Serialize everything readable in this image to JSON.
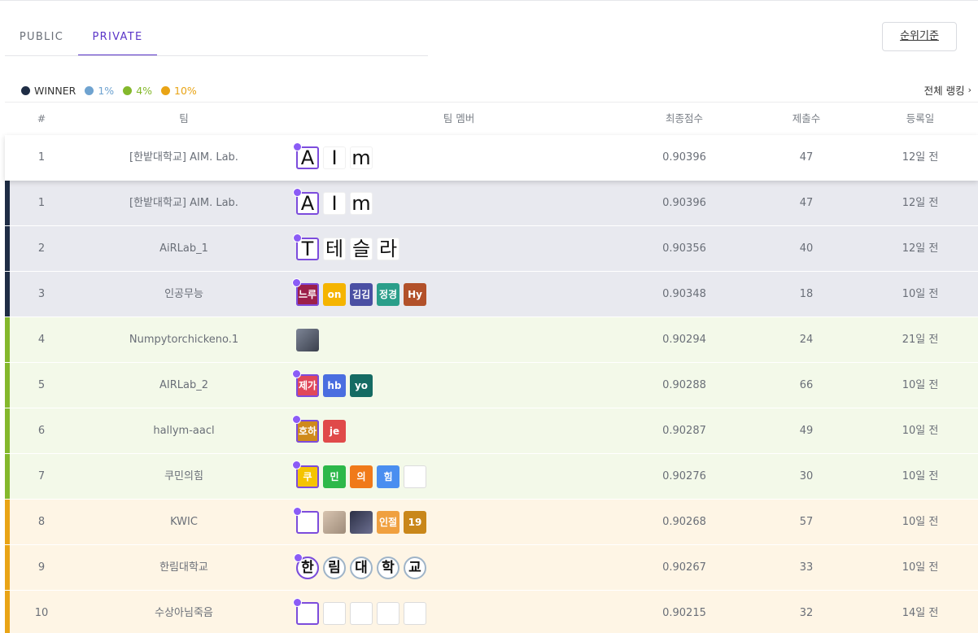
{
  "tabs": [
    {
      "label": "PUBLIC"
    },
    {
      "label": "PRIVATE"
    }
  ],
  "criteria_button": "순위기준",
  "legend": [
    {
      "label": "WINNER",
      "color": "#1f2d45"
    },
    {
      "label": "1%",
      "color": "#6fa3d0"
    },
    {
      "label": "4%",
      "color": "#84b82c"
    },
    {
      "label": "10%",
      "color": "#e9a416"
    }
  ],
  "all_ranking": "전체 랭킹",
  "columns": {
    "rank": "#",
    "team": "팀",
    "members": "팀 멤버",
    "score": "최종점수",
    "submissions": "제출수",
    "date": "등록일"
  },
  "tier_colors": {
    "winner": {
      "bar": "#1f2d45",
      "bg": "#e8e9ef"
    },
    "four": {
      "bar": "#84b82c",
      "bg": "#f3f9e9"
    },
    "ten": {
      "bar": "#e9a416",
      "bg": "#fef5e5"
    }
  },
  "rows": [
    {
      "rank": "1",
      "team": "[한밭대학교] AIM. Lab.",
      "score": "0.90396",
      "submissions": "47",
      "date": "12일 전",
      "tier": "mine",
      "members": [
        {
          "text": "A",
          "style": "glyph",
          "leader": true
        },
        {
          "text": "I",
          "style": "glyph"
        },
        {
          "text": "m",
          "style": "glyph"
        }
      ]
    },
    {
      "rank": "1",
      "team": "[한밭대학교] AIM. Lab.",
      "score": "0.90396",
      "submissions": "47",
      "date": "12일 전",
      "tier": "winner",
      "members": [
        {
          "text": "A",
          "style": "glyph",
          "leader": true
        },
        {
          "text": "I",
          "style": "glyph"
        },
        {
          "text": "m",
          "style": "glyph"
        }
      ]
    },
    {
      "rank": "2",
      "team": "AiRLab_1",
      "score": "0.90356",
      "submissions": "40",
      "date": "12일 전",
      "tier": "winner",
      "members": [
        {
          "text": "T",
          "style": "glyph",
          "leader": true
        },
        {
          "text": "테",
          "style": "glyph"
        },
        {
          "text": "슬",
          "style": "glyph"
        },
        {
          "text": "라",
          "style": "glyph"
        }
      ]
    },
    {
      "rank": "3",
      "team": "인공무능",
      "score": "0.90348",
      "submissions": "18",
      "date": "10일 전",
      "tier": "winner",
      "members": [
        {
          "text": "느루",
          "color": "#9c1f4a",
          "leader": true
        },
        {
          "text": "on",
          "color": "#f5b400"
        },
        {
          "text": "김김",
          "color": "#4a4fa3"
        },
        {
          "text": "정경",
          "color": "#2a9e8a"
        },
        {
          "text": "Hy",
          "color": "#b2512a"
        }
      ]
    },
    {
      "rank": "4",
      "team": "Numpytorchickeno.1",
      "score": "0.90294",
      "submissions": "24",
      "date": "21일 전",
      "tier": "four",
      "members": [
        {
          "text": "",
          "style": "photo"
        }
      ]
    },
    {
      "rank": "5",
      "team": "AIRLab_2",
      "score": "0.90288",
      "submissions": "66",
      "date": "10일 전",
      "tier": "four",
      "members": [
        {
          "text": "제가",
          "color": "#e0485a",
          "leader": true
        },
        {
          "text": "hb",
          "color": "#4a6ee0"
        },
        {
          "text": "yo",
          "color": "#156b63"
        }
      ]
    },
    {
      "rank": "6",
      "team": "hallym-aacl",
      "score": "0.90287",
      "submissions": "49",
      "date": "10일 전",
      "tier": "four",
      "members": [
        {
          "text": "호하",
          "color": "#cf8a1b",
          "leader": true
        },
        {
          "text": "je",
          "color": "#e04a4a"
        }
      ]
    },
    {
      "rank": "7",
      "team": "쿠민의힘",
      "score": "0.90276",
      "submissions": "30",
      "date": "10일 전",
      "tier": "four",
      "members": [
        {
          "text": "쿠",
          "color": "#f5c400",
          "leader": true
        },
        {
          "text": "민",
          "color": "#2db84a"
        },
        {
          "text": "의",
          "color": "#f07a1a"
        },
        {
          "text": "힘",
          "color": "#4a8ef0"
        },
        {
          "text": "",
          "style": "sketch"
        }
      ]
    },
    {
      "rank": "8",
      "team": "KWIC",
      "score": "0.90268",
      "submissions": "57",
      "date": "10일 전",
      "tier": "ten",
      "members": [
        {
          "text": "",
          "style": "sketch",
          "leader": true
        },
        {
          "text": "",
          "style": "photo2"
        },
        {
          "text": "",
          "style": "photo3"
        },
        {
          "text": "인절",
          "color": "#f0a040"
        },
        {
          "text": "19",
          "color": "#c9871a"
        }
      ]
    },
    {
      "rank": "9",
      "team": "한림대학교",
      "score": "0.90267",
      "submissions": "33",
      "date": "10일 전",
      "tier": "ten",
      "members": [
        {
          "text": "한",
          "style": "seal",
          "leader": true
        },
        {
          "text": "림",
          "style": "seal"
        },
        {
          "text": "대",
          "style": "seal"
        },
        {
          "text": "학",
          "style": "seal"
        },
        {
          "text": "교",
          "style": "seal"
        }
      ]
    },
    {
      "rank": "10",
      "team": "수상아님죽음",
      "score": "0.90215",
      "submissions": "32",
      "date": "14일 전",
      "tier": "ten",
      "members": [
        {
          "text": "",
          "style": "sketch",
          "leader": true
        },
        {
          "text": "",
          "style": "sketch"
        },
        {
          "text": "",
          "style": "sketch"
        },
        {
          "text": "",
          "style": "sketch"
        },
        {
          "text": "",
          "style": "sketch"
        }
      ]
    }
  ]
}
